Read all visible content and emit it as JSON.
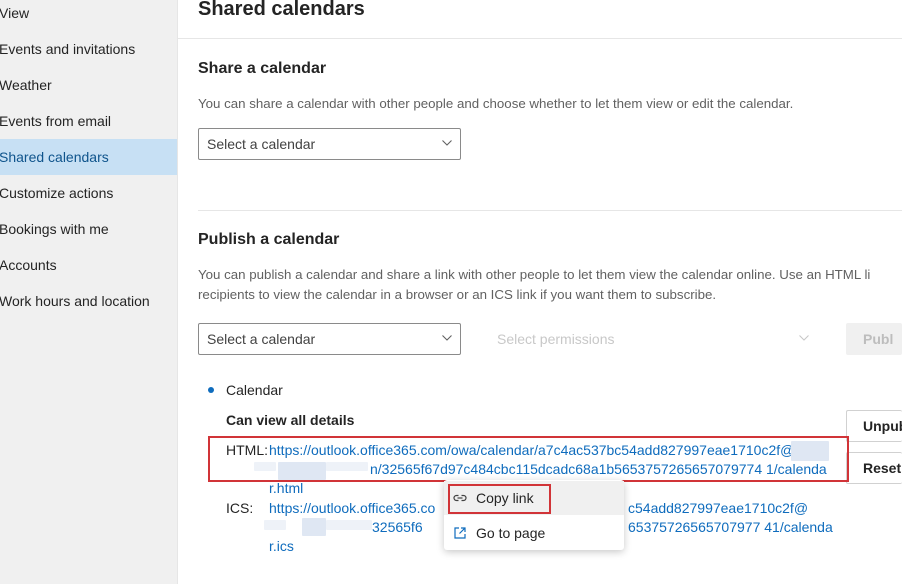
{
  "sidebar": {
    "items": [
      {
        "label": "View"
      },
      {
        "label": "Events and invitations"
      },
      {
        "label": "Weather"
      },
      {
        "label": "Events from email"
      },
      {
        "label": "Shared calendars",
        "selected": true
      },
      {
        "label": "Customize actions"
      },
      {
        "label": "Bookings with me"
      },
      {
        "label": "Accounts"
      },
      {
        "label": "Work hours and location"
      }
    ]
  },
  "page": {
    "title": "Shared calendars"
  },
  "share": {
    "title": "Share a calendar",
    "description": "You can share a calendar with other people and choose whether to let them view or edit the calendar.",
    "select_placeholder": "Select a calendar"
  },
  "publish": {
    "title": "Publish a calendar",
    "description_line1": "You can publish a calendar and share a link with other people to let them view the calendar online. Use an HTML li",
    "description_line2": "recipients to view the calendar in a browser or an ICS link if you want them to subscribe.",
    "select_placeholder": "Select a calendar",
    "permissions_placeholder": "Select permissions",
    "publish_button": "Publ",
    "calendar_name": "Calendar",
    "permission_level": "Can view all details",
    "html_label": "HTML:",
    "html_link_line1": "https://outlook.office365.com/owa/calendar/a7c4ac537bc54add827997eae1710c2f@",
    "html_link_line2_tail": "n/32565f67d97c484cbc115dcadc68a1b5653757265657079774 1/calenda",
    "html_link_line3": "r.html",
    "ics_label": "ICS:",
    "ics_link_line1_head": "https://outlook.office365.co",
    "ics_link_line1_tail": "c54add827997eae1710c2f@",
    "ics_link_line2_mid": "32565f6",
    "ics_link_line2_tail": "65375726565707977 41/calenda",
    "ics_link_line3": "r.ics",
    "unpublish_button": "Unpub",
    "reset_button": "Reset l"
  },
  "context_menu": {
    "items": [
      {
        "label": "Copy link",
        "icon": "link-icon"
      },
      {
        "label": "Go to page",
        "icon": "open-in-new-icon"
      }
    ]
  },
  "colors": {
    "accent": "#0f6cbd",
    "selected_bg": "#c7e0f4",
    "annotation_red": "#d13438"
  }
}
